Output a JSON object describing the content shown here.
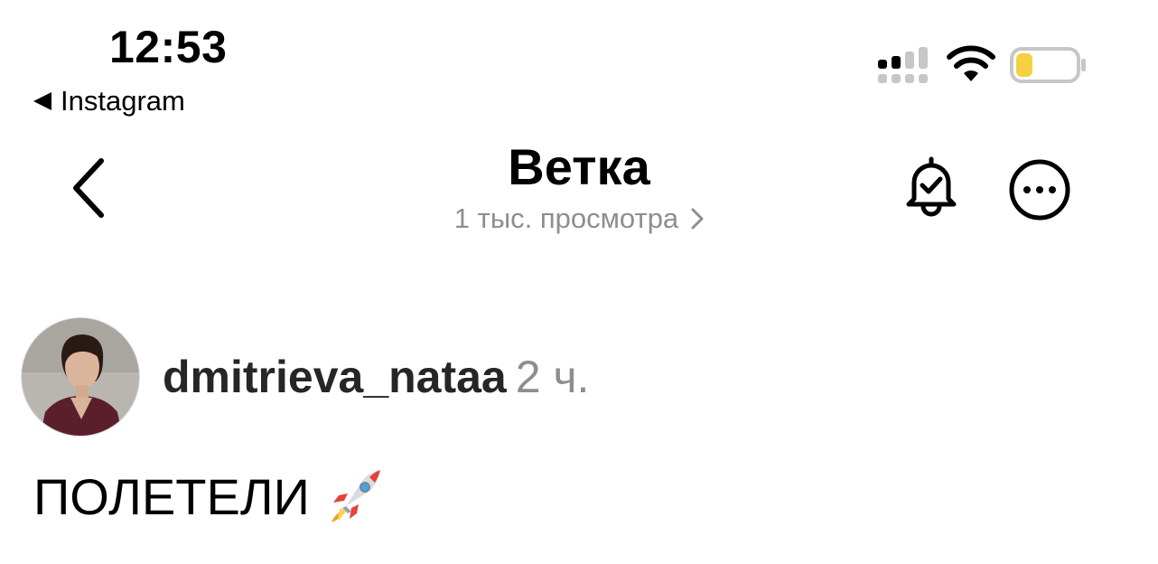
{
  "status_bar": {
    "time": "12:53",
    "back_app_label": "Instagram",
    "battery_color": "#f5d142"
  },
  "header": {
    "title": "Ветка",
    "views": "1 тыс. просмотра",
    "icons": [
      "back-chevron-icon",
      "bell-check-icon",
      "more-dots-icon",
      "chevron-right-icon"
    ]
  },
  "post": {
    "username": "dmitrieva_nataa",
    "time": "2 ч.",
    "text": "ПОЛЕТЕЛИ",
    "emoji": "rocket-emoji"
  }
}
